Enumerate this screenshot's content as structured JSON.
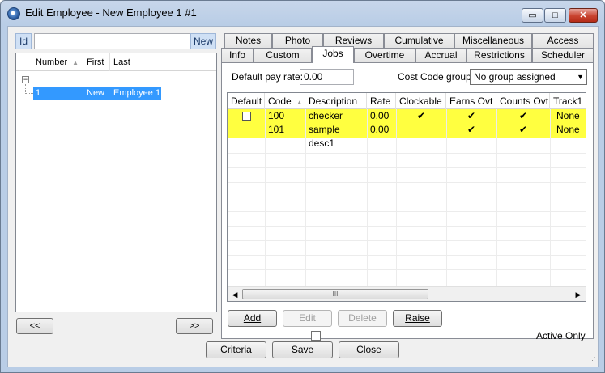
{
  "window": {
    "title": "Edit Employee - New Employee 1 #1",
    "controls": {
      "minimize": "▭",
      "maximize": "□",
      "close": "✕"
    }
  },
  "left_pane": {
    "id_label": "Id",
    "id_value": "",
    "new_button": "New",
    "columns": [
      "Number",
      "First",
      "Last"
    ],
    "tree": {
      "expander": "−",
      "rows": [
        {
          "number": "1",
          "first": "New",
          "last": "Employee 1"
        }
      ]
    },
    "prev_button": "<<",
    "next_button": ">>"
  },
  "tabs": {
    "row_back": [
      "Notes",
      "Photo",
      "Reviews",
      "Cumulative",
      "Miscellaneous",
      "Access"
    ],
    "row_front": [
      "Info",
      "Custom",
      "Jobs",
      "Overtime",
      "Accrual",
      "Restrictions",
      "Scheduler"
    ],
    "active": "Jobs"
  },
  "jobs": {
    "pay_rate_label": "Default pay rate:",
    "pay_rate_value": "0.00",
    "cost_code_label": "Cost Code group:",
    "cost_code_value": "No group assigned",
    "columns": [
      "Default",
      "Code",
      "Description",
      "Rate",
      "Clockable",
      "Earns Ovt",
      "Counts Ovt",
      "Track1"
    ],
    "rows": [
      {
        "default": "checkbox",
        "code": "100",
        "description": "checker",
        "rate": "0.00",
        "clockable": "✔",
        "earns_ovt": "✔",
        "counts_ovt": "✔",
        "track1": "None"
      },
      {
        "default": "",
        "code": "101",
        "description": "sample desc1",
        "rate": "0.00",
        "clockable": "",
        "earns_ovt": "✔",
        "counts_ovt": "✔",
        "track1": "None"
      }
    ],
    "row_highlight_color": "#ffff40",
    "scroll_thumb_glyph": "III",
    "buttons": {
      "add": "Add",
      "edit": "Edit",
      "delete": "Delete",
      "raise": "Raise"
    },
    "active_only_label": "Active Only",
    "active_only_checked": false
  },
  "footer": {
    "criteria": "Criteria",
    "save": "Save",
    "close": "Close"
  }
}
